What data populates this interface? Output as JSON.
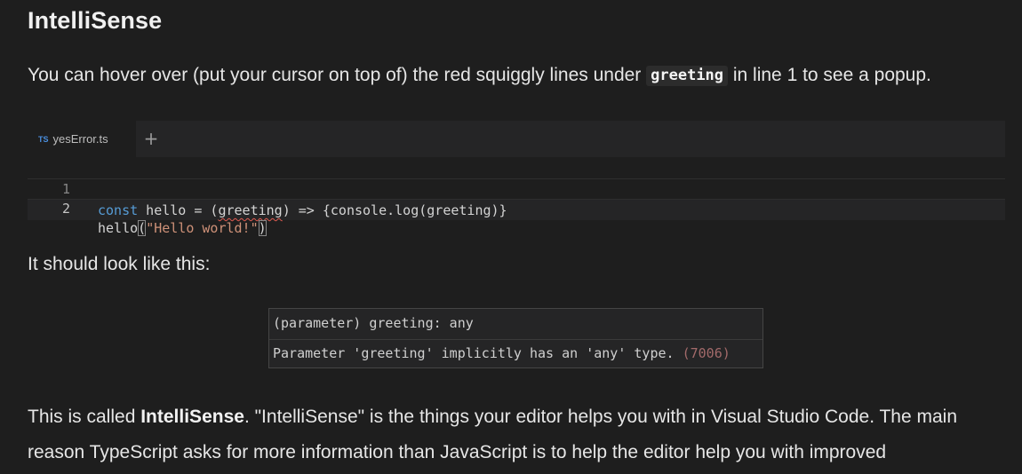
{
  "heading": "IntelliSense",
  "intro": {
    "before": "You can hover over (put your cursor on top of) the red squiggly lines under ",
    "code": "greeting",
    "after": " in line 1 to see a popup."
  },
  "editor": {
    "tab": {
      "icon": "TS",
      "filename": "yesError.ts"
    },
    "add_tab_icon": "+",
    "lines": [
      {
        "number": "1",
        "kw": "const",
        "pre": " hello = (",
        "squiggle": "greeting",
        "post": ") => {console.log(greeting)}"
      },
      {
        "number": "2",
        "pre": "hello",
        "open_paren": "(",
        "string": "\"Hello world!\"",
        "close_paren": ")"
      }
    ]
  },
  "look_like": "It should look like this:",
  "popup": {
    "signature": "(parameter) greeting: any",
    "message": "Parameter 'greeting' implicitly has an 'any' type.",
    "error_code": "(7006)"
  },
  "outro": {
    "before": "This is called ",
    "bold": "IntelliSense",
    "after": ". \"IntelliSense\" is the things your editor helps you with in Visual Studio Code. The main reason TypeScript asks for more information than JavaScript is to help the editor help you with improved"
  },
  "colors": {
    "background": "#1e1e1e",
    "keyword": "#569cd6",
    "string": "#ce9178",
    "squiggle": "#e05a4f",
    "ts_icon": "#4a8fe0"
  }
}
